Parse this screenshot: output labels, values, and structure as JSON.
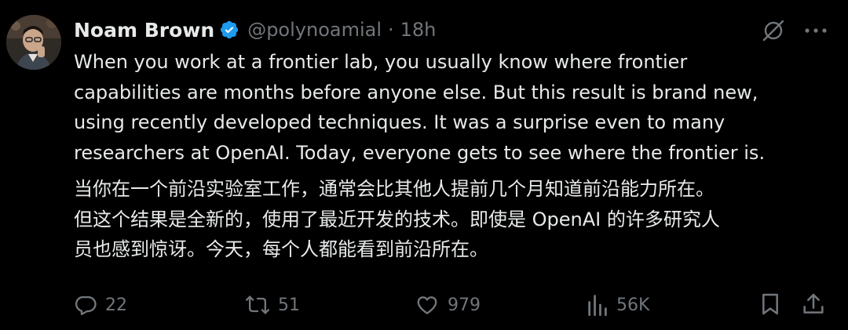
{
  "author": {
    "display_name": "Noam Brown",
    "handle": "@polynoamial",
    "separator": "·",
    "time": "18h",
    "verified": true
  },
  "tweet": {
    "text_en": "When you work at a frontier lab, you usually know where frontier\ncapabilities are months before anyone else. But this result is brand new,\nusing recently developed techniques. It was a surprise even to many\nresearchers at OpenAI. Today, everyone gets to see where the frontier is.",
    "text_zh": "当你在一个前沿实验室工作，通常会比其他人提前几个月知道前沿能力所在。\n但这个结果是全新的，使用了最近开发的技术。即使是 OpenAI 的许多研究人\n员也感到惊讶。今天，每个人都能看到前沿所在。"
  },
  "actions": {
    "replies": "22",
    "reposts": "51",
    "likes": "979",
    "views": "56K"
  },
  "icons": {
    "verified": "verified-badge-icon",
    "grok": "grok-icon",
    "more": "more-icon",
    "reply": "reply-icon",
    "repost": "repost-icon",
    "like": "like-icon",
    "views": "views-icon",
    "bookmark": "bookmark-icon",
    "share": "share-icon"
  },
  "colors": {
    "background": "#000000",
    "text": "#e7e9ea",
    "muted": "#71767b",
    "verified": "#1d9bf0"
  }
}
